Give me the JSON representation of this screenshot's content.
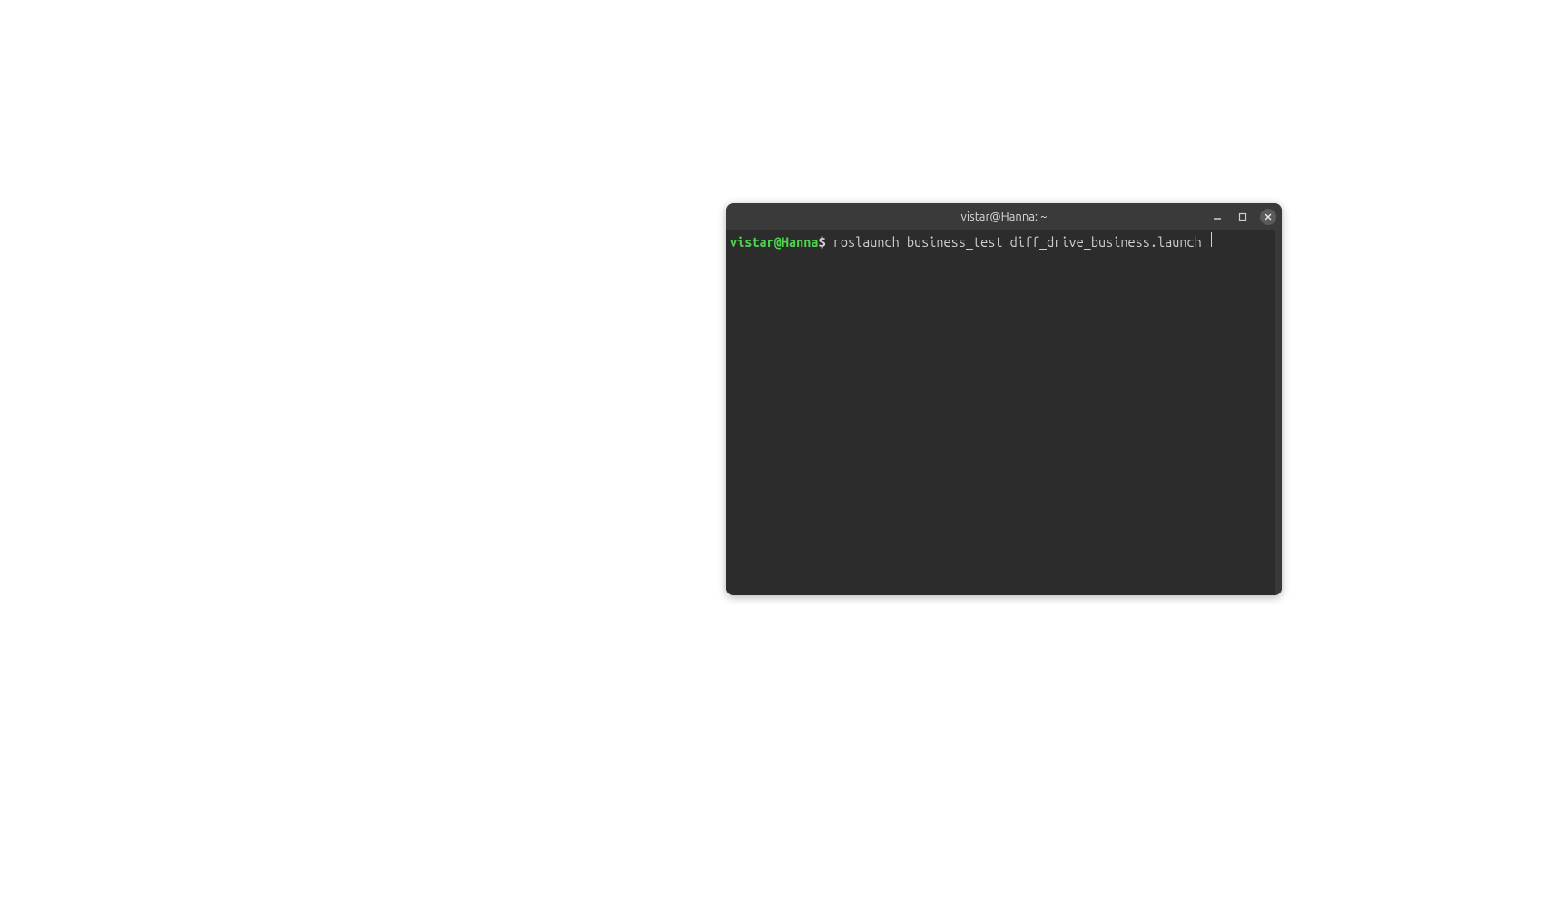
{
  "window": {
    "title": "vistar@Hanna: ~"
  },
  "terminal": {
    "prompt_user_host": "vistar@Hanna",
    "prompt_symbol": "$",
    "command": " roslaunch business_test diff_drive_business.launch "
  },
  "colors": {
    "prompt": "#4fd24f",
    "text": "#d0d0d0",
    "background": "#2c2c2c",
    "titlebar": "#3a3a3a"
  }
}
